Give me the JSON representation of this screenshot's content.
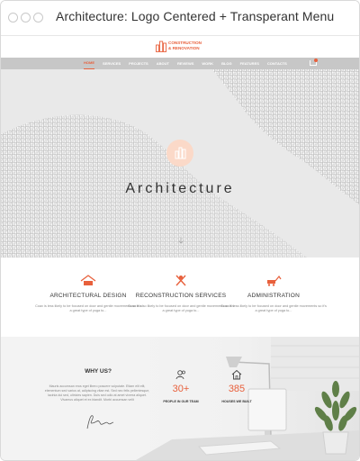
{
  "window": {
    "title": "Architecture: Logo Centered + Transperant Menu"
  },
  "brand": {
    "line1": "CONSTRUCTION",
    "line2": "& RENOVATION",
    "accent": "#e8603c"
  },
  "menu": {
    "items": [
      {
        "label": "HOME",
        "active": true
      },
      {
        "label": "SERVICES",
        "active": false
      },
      {
        "label": "PROJECTS",
        "active": false
      },
      {
        "label": "ABOUT",
        "active": false
      },
      {
        "label": "REVIEWS",
        "active": false
      },
      {
        "label": "WORK",
        "active": false
      },
      {
        "label": "BLOG",
        "active": false
      },
      {
        "label": "FEATURES",
        "active": false
      },
      {
        "label": "CONTACTS",
        "active": false
      }
    ],
    "cart_icon": "cart-icon"
  },
  "hero": {
    "title": "Architecture",
    "badge_icon": "building-icon",
    "scroll_icon": "arrow-down-icon"
  },
  "services": [
    {
      "title": "ARCHITECTURAL DESIGN",
      "icon": "house-icon",
      "desc": "Coax is less likely to be focused on door and gentle movements so it's a great type of yoga to..."
    },
    {
      "title": "RECONSTRUCTION SERVICES",
      "icon": "tools-icon",
      "desc": "Coax is also likely to be focused on door and gentle movements so it's a great type of yoga to..."
    },
    {
      "title": "ADMINISTRATION",
      "icon": "excavator-icon",
      "desc": "Coax is less likely to be focused on door and gentle movements so it's a great type of yoga to..."
    }
  ],
  "why": {
    "title": "WHY US?",
    "text": "Mauris accumsan eros eget libero posuere vulputate. Etiam elit elit, elementum sed varius at, adipiscing vitae est. Sed nec felis pellentesque, lacinia dui sed, ultricies sapien. Duis sed odio at amet viverra aliquet. Vivamus aliquet et ex blandit. Morbi accumsan velit",
    "signature_icon": "signature-icon"
  },
  "stats": [
    {
      "value": "30+",
      "label": "PEOPLE IN OUR TEAM",
      "icon": "people-icon"
    },
    {
      "value": "385",
      "label": "HOUSES WE BUILT",
      "icon": "home-icon"
    }
  ]
}
